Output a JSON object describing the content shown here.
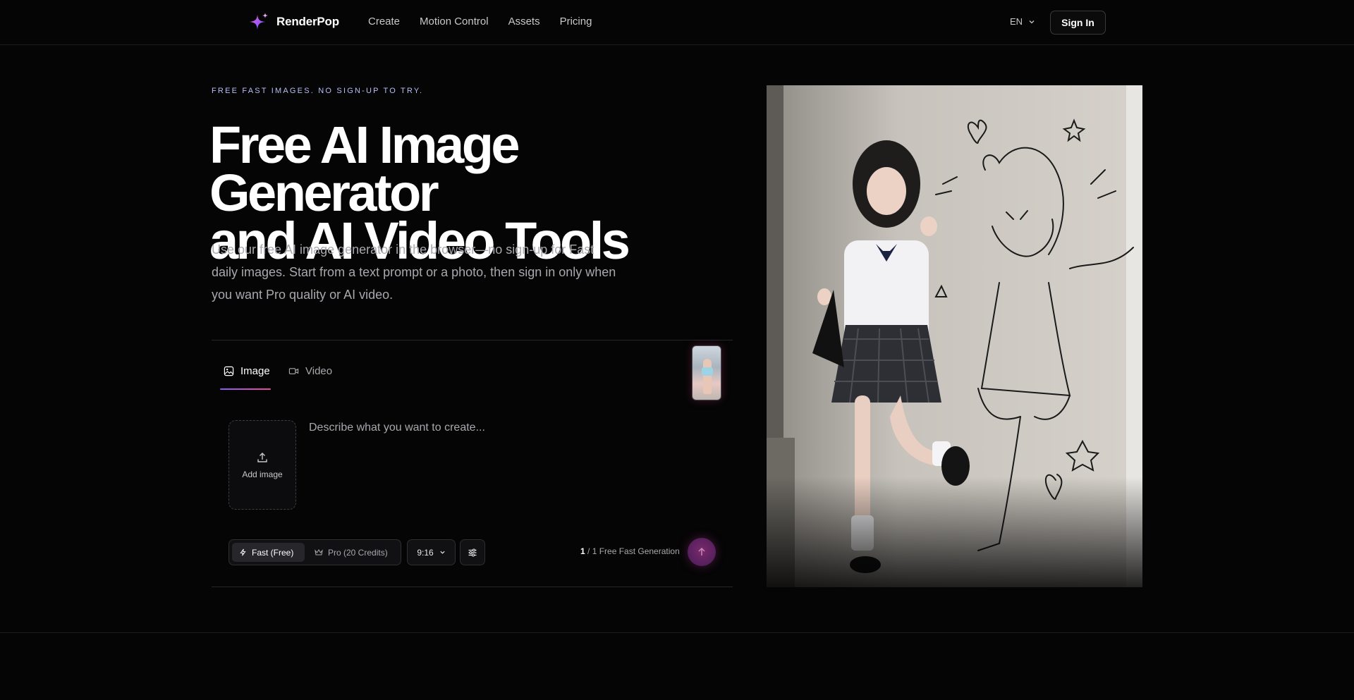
{
  "brand": {
    "name": "RenderPop",
    "logo_icon": "sparkle-star-icon"
  },
  "nav": {
    "items": [
      "Create",
      "Motion Control",
      "Assets",
      "Pricing"
    ]
  },
  "header": {
    "language": "EN",
    "sign_in_label": "Sign In"
  },
  "hero": {
    "eyebrow": "FREE FAST IMAGES. NO SIGN-UP TO TRY.",
    "title_line1": "Free AI Image Generator",
    "title_line2": "and AI Video Tools",
    "subtitle": "Use our free AI image generator in the browser—no sign-up for Fast daily images. Start from a text prompt or a photo, then sign in only when you want Pro quality or AI video."
  },
  "generator": {
    "tabs": [
      {
        "label": "Image",
        "icon": "image-icon",
        "active": true
      },
      {
        "label": "Video",
        "icon": "video-camera-icon",
        "active": false
      }
    ],
    "add_image_label": "Add image",
    "prompt_placeholder": "Describe what you want to create...",
    "modes": [
      {
        "label": "Fast (Free)",
        "icon": "bolt-icon",
        "selected": true
      },
      {
        "label": "Pro (20 Credits)",
        "icon": "crown-icon",
        "selected": false
      }
    ],
    "aspect_ratio": "9:16",
    "quota_used": "1",
    "quota_text": " / 1 Free Fast Generation"
  },
  "colors": {
    "accent_start": "#8b5cf6",
    "accent_end": "#ec4899",
    "background": "#050505"
  }
}
